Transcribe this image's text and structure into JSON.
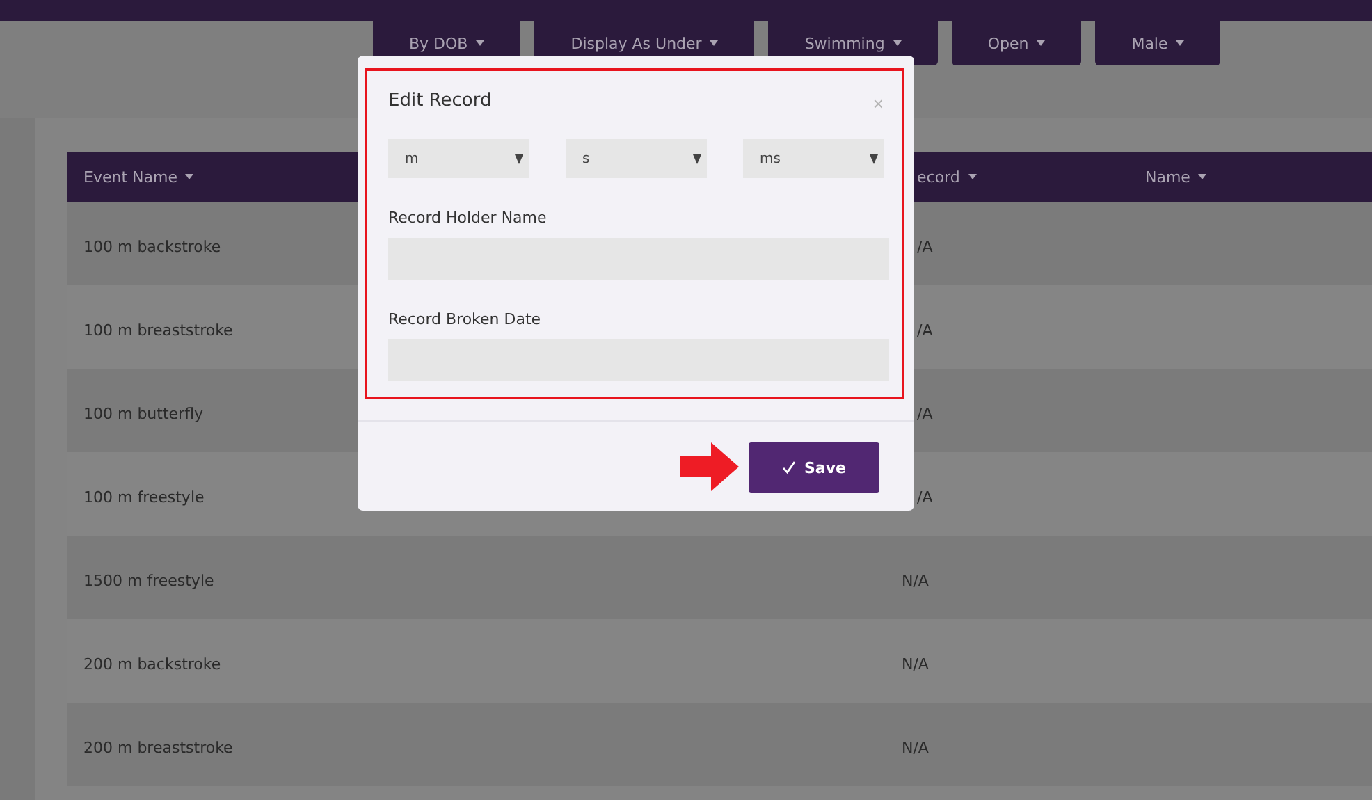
{
  "filters": [
    {
      "label": "By DOB"
    },
    {
      "label": "Display As Under"
    },
    {
      "label": "Swimming"
    },
    {
      "label": "Open"
    },
    {
      "label": "Male"
    }
  ],
  "table": {
    "columns": [
      "Event Name",
      "ecord",
      "Name"
    ],
    "rows": [
      {
        "cells": [
          "100 m backstroke",
          "/A"
        ]
      },
      {
        "cells": [
          "100 m breaststroke",
          "/A"
        ]
      },
      {
        "cells": [
          "100 m butterfly",
          "/A"
        ]
      },
      {
        "cells": [
          "100 m freestyle",
          "/A"
        ]
      },
      {
        "cells": [
          "1500 m freestyle",
          "N/A"
        ]
      },
      {
        "cells": [
          "200 m backstroke",
          "N/A"
        ]
      },
      {
        "cells": [
          "200 m breaststroke",
          "N/A"
        ]
      }
    ]
  },
  "modal": {
    "title": "Edit Record",
    "close": "×",
    "time_selects": [
      {
        "value": "m"
      },
      {
        "value": "s"
      },
      {
        "value": "ms"
      }
    ],
    "fields": [
      {
        "label": "Record Holder Name"
      },
      {
        "label": "Record Broken Date"
      }
    ],
    "save_button": {
      "label": "Save"
    }
  }
}
